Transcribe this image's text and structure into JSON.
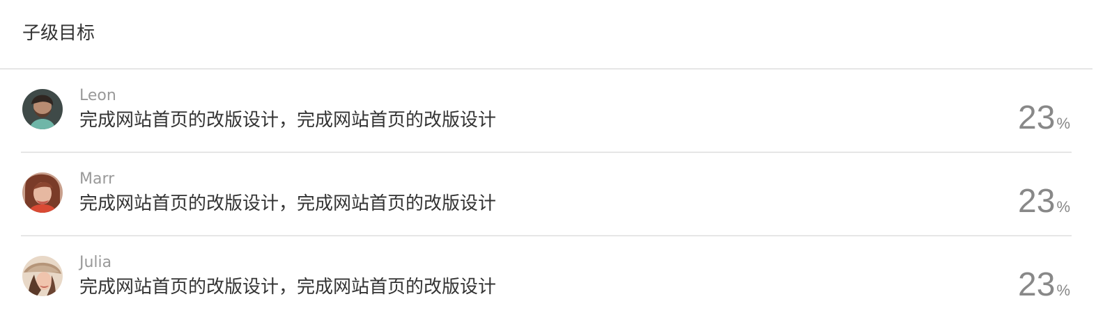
{
  "header": {
    "title": "子级目标"
  },
  "goals": [
    {
      "owner": "Leon",
      "avatar_icon": "avatar-leon",
      "text": "完成网站首页的改版设计，完成网站首页的改版设计",
      "progress": "23",
      "unit": "%"
    },
    {
      "owner": "Marr",
      "avatar_icon": "avatar-marr",
      "text": "完成网站首页的改版设计，完成网站首页的改版设计",
      "progress": "23",
      "unit": "%"
    },
    {
      "owner": "Julia",
      "avatar_icon": "avatar-julia",
      "text": "完成网站首页的改版设计，完成网站首页的改版设计",
      "progress": "23",
      "unit": "%"
    }
  ]
}
